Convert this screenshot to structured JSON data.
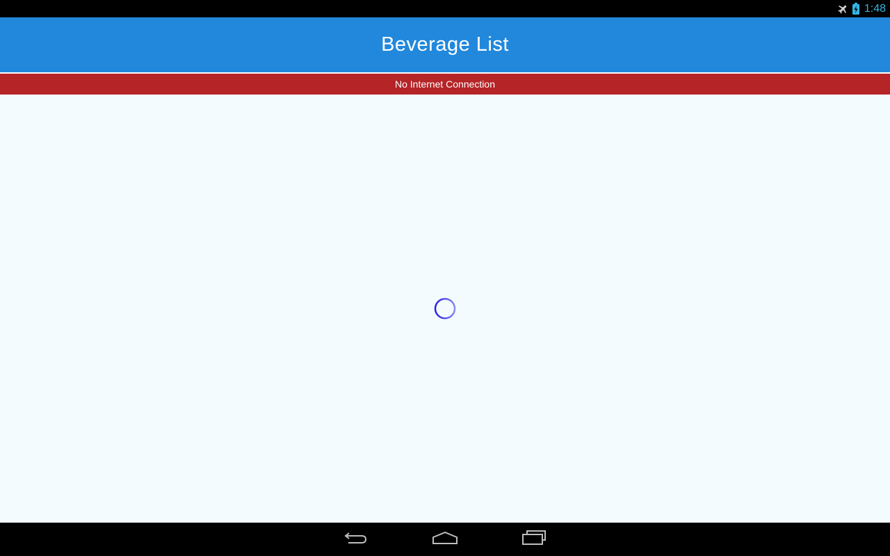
{
  "status_bar": {
    "time": "1:48",
    "icons": [
      "airplane-mode-icon",
      "battery-charging-icon"
    ],
    "time_color": "#33b5e5"
  },
  "app_bar": {
    "title": "Beverage List",
    "color": "#2188dc"
  },
  "banner": {
    "text": "No Internet Connection",
    "color": "#b52427"
  },
  "content": {
    "state": "loading",
    "background": "#f3fbfe",
    "spinner_color": "#2a1fe0"
  },
  "nav_bar": {
    "buttons": [
      "back-icon",
      "home-icon",
      "recent-apps-icon"
    ]
  }
}
